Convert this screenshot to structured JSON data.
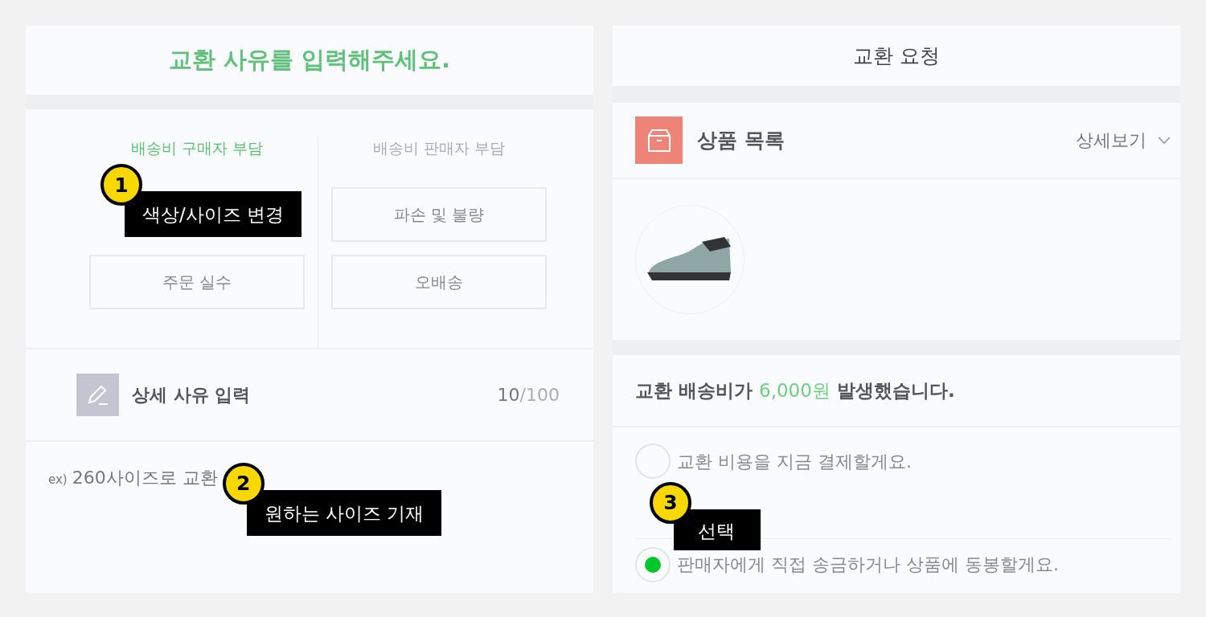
{
  "reason_panel": {
    "title": "교환 사유를 입력해주세요.",
    "groups": [
      {
        "title": "배송비 구매자 부담",
        "selected": true,
        "options": [
          {
            "kind": "callout",
            "number": "1",
            "label": "색상/사이즈 변경"
          },
          {
            "kind": "button",
            "label": "주문 실수"
          }
        ]
      },
      {
        "title": "배송비 판매자 부담",
        "selected": false,
        "options": [
          {
            "kind": "button",
            "label": "파손 및 불량"
          },
          {
            "kind": "button",
            "label": "오배송"
          }
        ]
      }
    ],
    "detail": {
      "title": "상세 사유 입력",
      "count": "10",
      "max": "/100",
      "prefix": "ex)",
      "value": "260사이즈로 교환",
      "callout": {
        "number": "2",
        "label": "원하는 사이즈 기재"
      }
    }
  },
  "request_panel": {
    "title": "교환 요청",
    "list_title": "상품 목록",
    "detail_link": "상세보기",
    "fee": {
      "before": "교환 배송비가 ",
      "amount": "6,000원",
      "after": " 발생했습니다."
    },
    "payment_options": [
      {
        "label": "교환 비용을 지금 결제할게요.",
        "selected": false
      },
      {
        "label": "판매자에게 직접 송금하거나 상품에 동봉할게요.",
        "selected": true
      }
    ],
    "callout": {
      "number": "3",
      "label": "선택"
    }
  }
}
